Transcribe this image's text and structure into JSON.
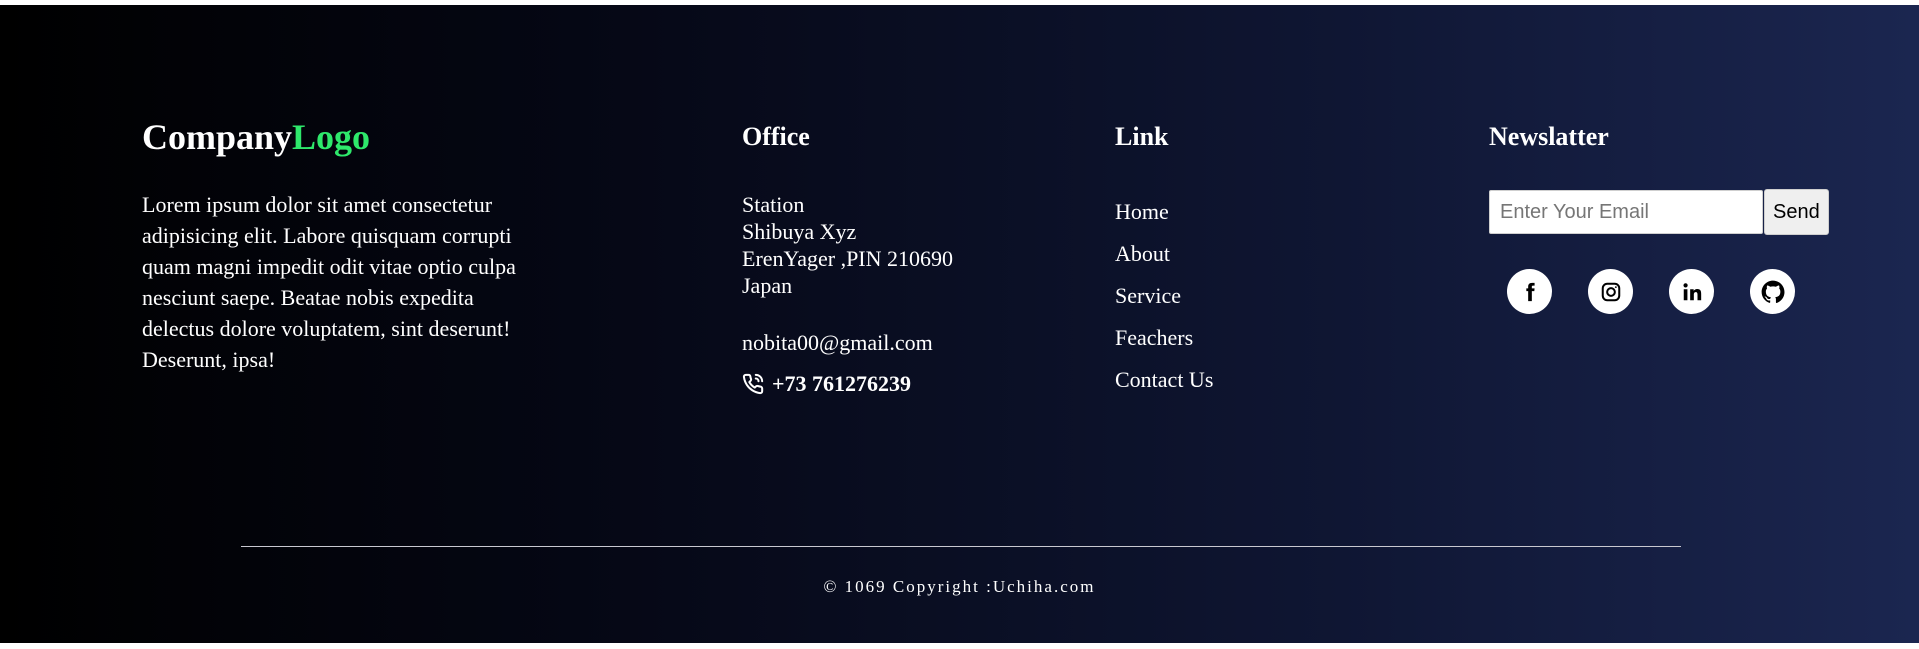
{
  "brand": {
    "logo_main": "Company",
    "logo_accent": "Logo",
    "description": "Lorem ipsum dolor sit amet consectetur adipisicing elit. Labore quisquam corrupti quam magni impedit odit vitae optio culpa nesciunt saepe. Beatae nobis expedita delectus dolore voluptatem, sint deserunt! Deserunt, ipsa!"
  },
  "office": {
    "heading": "Office",
    "address_lines": [
      "Station",
      "Shibuya Xyz",
      "ErenYager ,PIN 210690",
      "Japan"
    ],
    "email": "nobita00@gmail.com",
    "phone": "+73 761276239",
    "phone_icon": "phone-icon"
  },
  "links": {
    "heading": "Link",
    "items": [
      "Home",
      "About",
      "Service",
      "Feachers",
      "Contact Us"
    ]
  },
  "newsletter": {
    "heading": "Newslatter",
    "placeholder": "Enter Your Email",
    "value": "",
    "send_label": "Send",
    "socials": [
      "facebook-icon",
      "instagram-icon",
      "linkedin-icon",
      "github-icon"
    ]
  },
  "footer": {
    "copyright": "© 1069 Copyright :Uchiha.com"
  },
  "colors": {
    "logo_accent": "#2ee86b",
    "background_start": "#000000",
    "background_end": "#1b2650",
    "text": "#ffffff"
  }
}
